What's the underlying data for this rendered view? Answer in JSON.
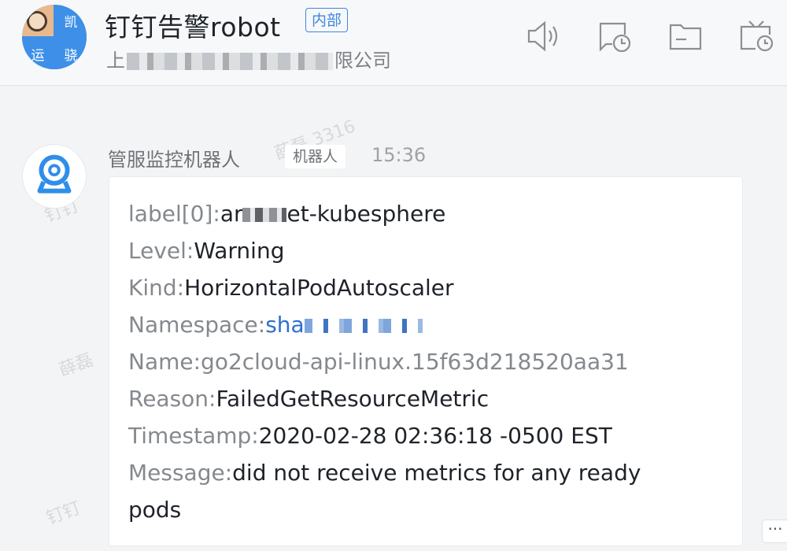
{
  "header": {
    "title": "钉钉告警robot",
    "internal_badge": "内部",
    "company_prefix": "上",
    "company_suffix": "限公司",
    "avatar_chars": [
      "凯",
      "运",
      "骁"
    ],
    "icons": [
      "speaker-icon",
      "chat-clock-icon",
      "folder-icon",
      "calendar-clock-icon"
    ]
  },
  "watermarks": [
    "薛磊 3316",
    "钉钉",
    "薛磊",
    "钉钉"
  ],
  "message": {
    "sender": "管服监控机器人",
    "sender_tag": "机器人",
    "time": "15:36",
    "lines": [
      {
        "key": "label[0]:",
        "value_start": "ar",
        "value_end": "et-kubesphere"
      },
      {
        "key": "Level:",
        "value": "Warning"
      },
      {
        "key": "Kind:",
        "value": "HorizontalPodAutoscaler"
      },
      {
        "key": "Namespace:",
        "value_start": "sha"
      },
      {
        "key": "Name:",
        "value": "go2cloud-api-linux.15f63d218520aa31"
      },
      {
        "key": "Reason:",
        "value": "FailedGetResourceMetric"
      },
      {
        "key": "Timestamp:",
        "value": "2020-02-28 02:36:18 -0500 EST"
      },
      {
        "key": "Message:",
        "value": "did not receive metrics for any ready"
      },
      {
        "value": "pods"
      }
    ]
  },
  "more_button": "···"
}
